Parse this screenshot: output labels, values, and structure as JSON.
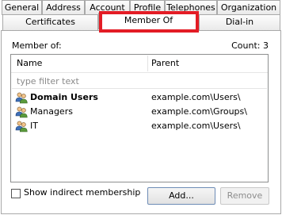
{
  "tabs_row1": [
    "General",
    "Address",
    "Account",
    "Profile",
    "Telephones",
    "Organization"
  ],
  "tabs_row2": [
    "Certificates",
    "Member Of",
    "Dial-in"
  ],
  "member_of_label": "Member of:",
  "count_label": "Count: 3",
  "columns": {
    "name": "Name",
    "parent": "Parent"
  },
  "filter_placeholder": "type filter text",
  "members": [
    {
      "name": "Domain Users",
      "parent": "example.com\\Users\\",
      "bold": true
    },
    {
      "name": "Managers",
      "parent": "example.com\\Groups\\",
      "bold": false
    },
    {
      "name": "IT",
      "parent": "example.com\\Users\\",
      "bold": false
    }
  ],
  "show_indirect_label": "Show indirect membership",
  "show_indirect_checked": false,
  "add_button": "Add...",
  "remove_button": "Remove",
  "highlight_color": "#e31c25",
  "icon": "group-users-icon"
}
